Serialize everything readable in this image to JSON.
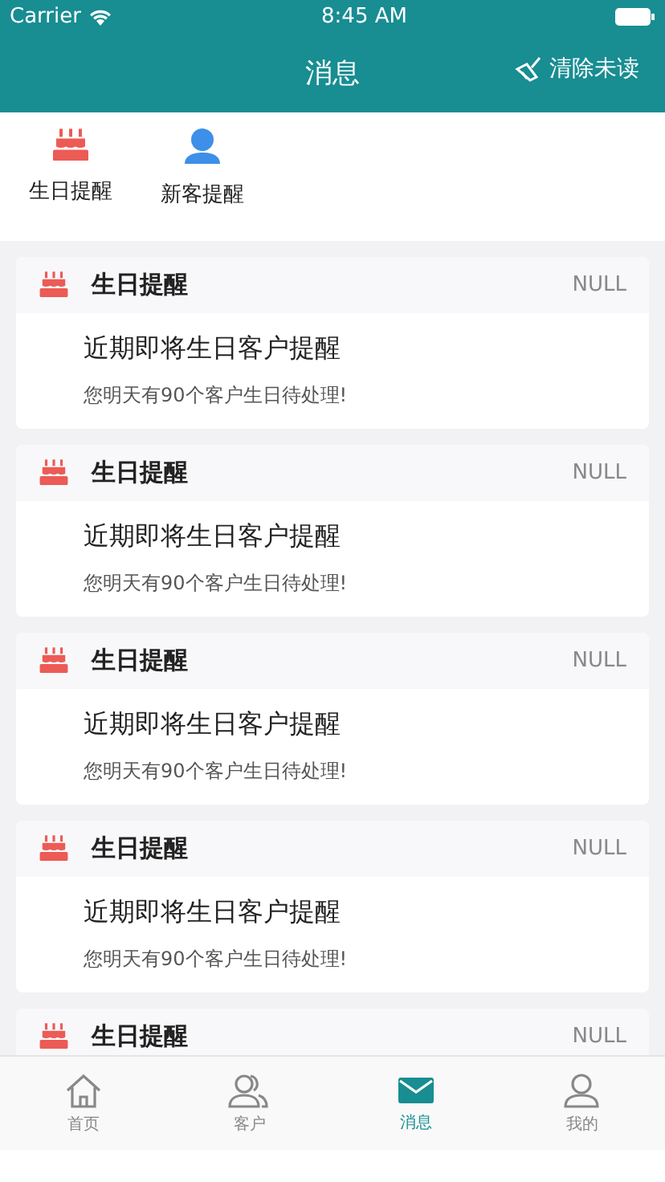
{
  "status_bar": {
    "carrier": "Carrier",
    "time": "8:45 AM"
  },
  "nav": {
    "title": "消息",
    "action": "清除未读"
  },
  "categories": [
    {
      "label": "生日提醒",
      "kind": "birthday"
    },
    {
      "label": "新客提醒",
      "kind": "newcustomer"
    }
  ],
  "messages": [
    {
      "type": "生日提醒",
      "tag": "NULL",
      "title": "近期即将生日客户提醒",
      "body": "您明天有90个客户生日待处理!"
    },
    {
      "type": "生日提醒",
      "tag": "NULL",
      "title": "近期即将生日客户提醒",
      "body": "您明天有90个客户生日待处理!"
    },
    {
      "type": "生日提醒",
      "tag": "NULL",
      "title": "近期即将生日客户提醒",
      "body": "您明天有90个客户生日待处理!"
    },
    {
      "type": "生日提醒",
      "tag": "NULL",
      "title": "近期即将生日客户提醒",
      "body": "您明天有90个客户生日待处理!"
    },
    {
      "type": "生日提醒",
      "tag": "NULL"
    }
  ],
  "tab_bar": [
    {
      "label": "首页",
      "kind": "home",
      "selected": false
    },
    {
      "label": "客户",
      "kind": "customers",
      "selected": false
    },
    {
      "label": "消息",
      "kind": "messages",
      "selected": true
    },
    {
      "label": "我的",
      "kind": "me",
      "selected": false
    }
  ]
}
